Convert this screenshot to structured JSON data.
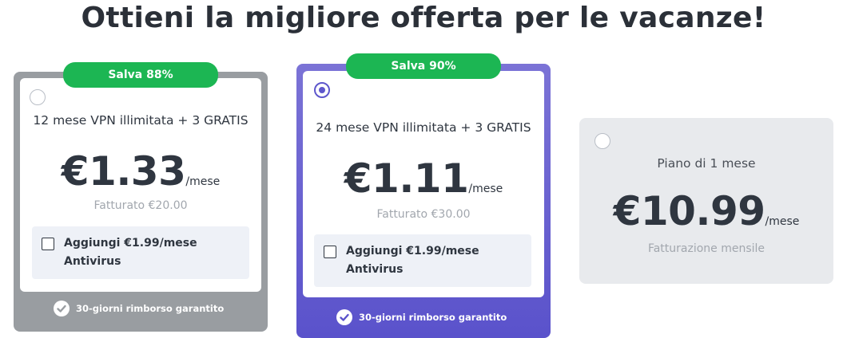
{
  "headline": "Ottieni la migliore offerta per le vacanze!",
  "plans": [
    {
      "badge": "Salva 88%",
      "name": "12 mese VPN illimitata + 3 GRATIS",
      "price": "€1.33",
      "period": "/mese",
      "billed": "Fatturato €20.00",
      "addon_line1": "Aggiungi €1.99/mese",
      "addon_line2": "Antivirus",
      "guarantee": "30-giorni rimborso garantito",
      "selected": false
    },
    {
      "badge": "Salva 90%",
      "name": "24 mese VPN illimitata + 3 GRATIS",
      "price": "€1.11",
      "period": "/mese",
      "billed": "Fatturato €30.00",
      "addon_line1": "Aggiungi €1.99/mese",
      "addon_line2": "Antivirus",
      "guarantee": "30-giorni rimborso garantito",
      "selected": true
    },
    {
      "name": "Piano di 1 mese",
      "price": "€10.99",
      "period": "/mese",
      "billed": "Fatturazione mensile",
      "selected": false
    }
  ],
  "icons": {
    "radio": "radio-button-icon",
    "checkbox": "checkbox-icon",
    "guarantee": "check-circle-icon"
  },
  "colors": {
    "badge_green": "#1cb653",
    "selected_purple": "#5e57cc",
    "unselected_gray": "#999da1",
    "plan3_background": "#e8eaed"
  }
}
